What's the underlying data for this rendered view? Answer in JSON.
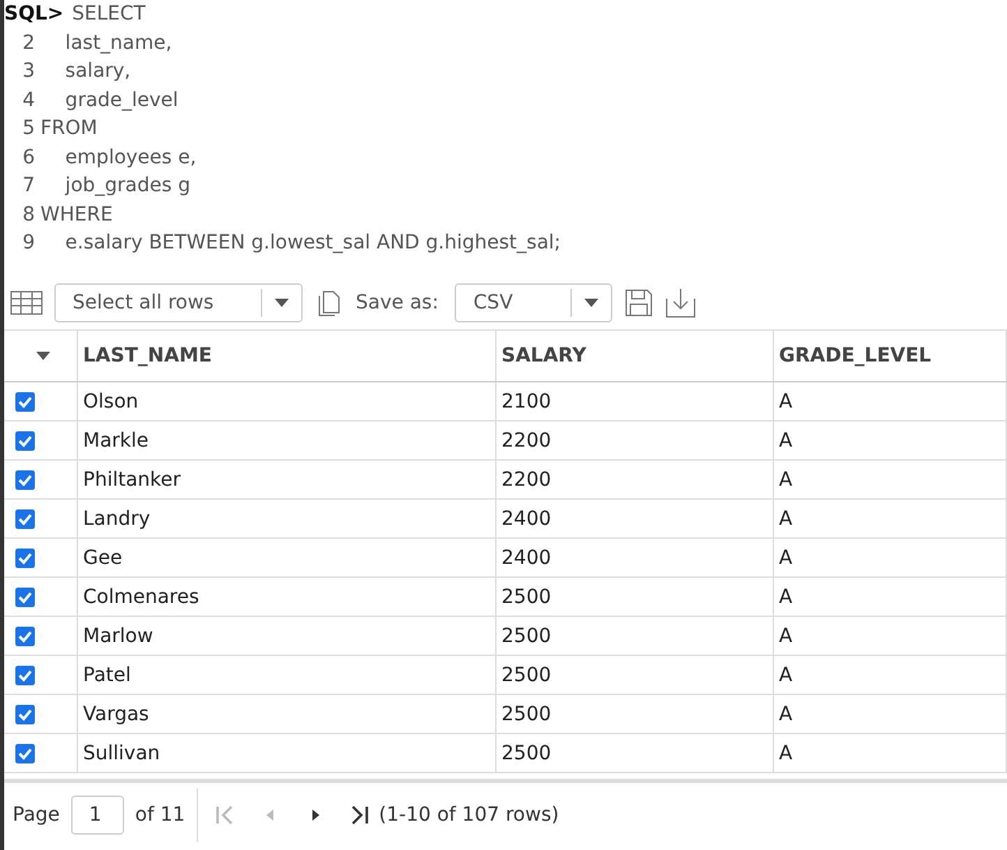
{
  "editor": {
    "prompt": "SQL>",
    "lines": [
      {
        "text": "SELECT"
      },
      {
        "number": "2",
        "text": "    last_name,"
      },
      {
        "number": "3",
        "text": "    salary,"
      },
      {
        "number": "4",
        "text": "    grade_level"
      },
      {
        "number": "5",
        "text": "FROM"
      },
      {
        "number": "6",
        "text": "    employees e,"
      },
      {
        "number": "7",
        "text": "    job_grades g"
      },
      {
        "number": "8",
        "text": "WHERE"
      },
      {
        "number": "9",
        "text": "    e.salary BETWEEN g.lowest_sal AND g.highest_sal;"
      }
    ]
  },
  "toolbar": {
    "selection": "Select all rows",
    "save_label": "Save as:",
    "format": "CSV"
  },
  "table": {
    "columns": [
      "LAST_NAME",
      "SALARY",
      "GRADE_LEVEL"
    ],
    "rows": [
      {
        "checked": true,
        "cells": [
          "Olson",
          "2100",
          "A"
        ]
      },
      {
        "checked": true,
        "cells": [
          "Markle",
          "2200",
          "A"
        ]
      },
      {
        "checked": true,
        "cells": [
          "Philtanker",
          "2200",
          "A"
        ]
      },
      {
        "checked": true,
        "cells": [
          "Landry",
          "2400",
          "A"
        ]
      },
      {
        "checked": true,
        "cells": [
          "Gee",
          "2400",
          "A"
        ]
      },
      {
        "checked": true,
        "cells": [
          "Colmenares",
          "2500",
          "A"
        ]
      },
      {
        "checked": true,
        "cells": [
          "Marlow",
          "2500",
          "A"
        ]
      },
      {
        "checked": true,
        "cells": [
          "Patel",
          "2500",
          "A"
        ]
      },
      {
        "checked": true,
        "cells": [
          "Vargas",
          "2500",
          "A"
        ]
      },
      {
        "checked": true,
        "cells": [
          "Sullivan",
          "2500",
          "A"
        ]
      }
    ]
  },
  "pager": {
    "page_label": "Page",
    "page": "1",
    "of_label": "of 11",
    "first_disabled": true,
    "prev_disabled": true,
    "next_disabled": false,
    "last_disabled": false,
    "summary": "(1-10 of 107 rows)"
  }
}
